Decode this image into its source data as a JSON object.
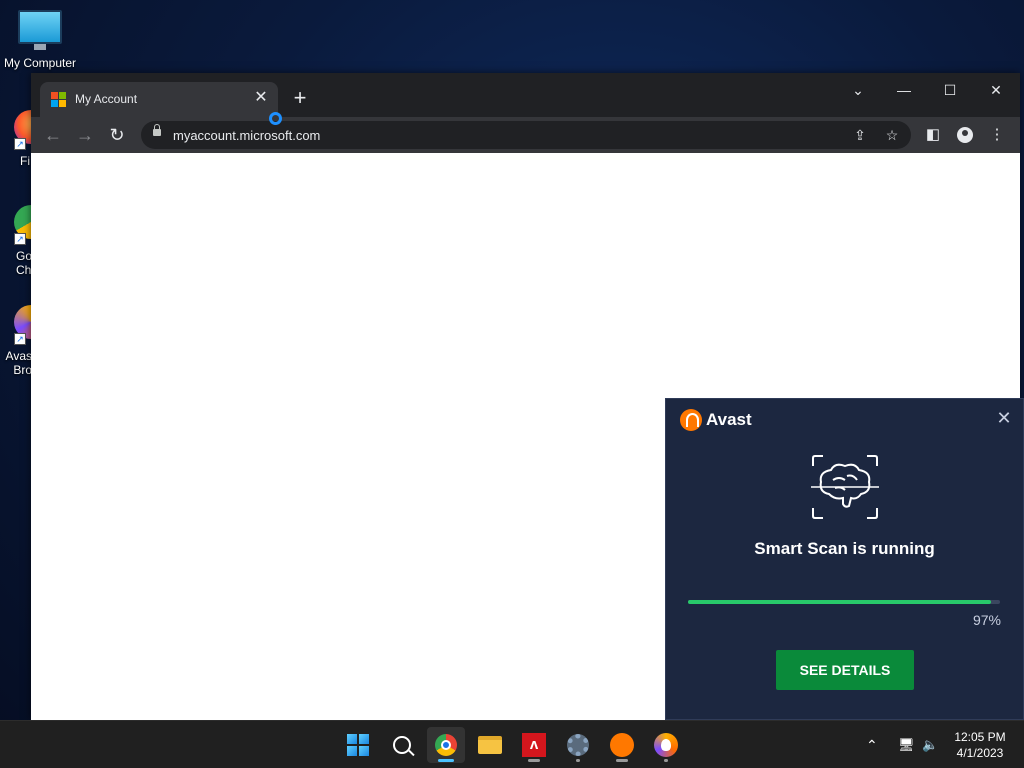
{
  "desktop": {
    "icons": [
      {
        "label": "My Computer",
        "icon": "monitor-icon"
      },
      {
        "label": "Fi",
        "icon": "firefox-icon"
      },
      {
        "label": "Go Ch",
        "icon": "chrome-icon"
      },
      {
        "label": "Avas Bro",
        "icon": "avast-browser-icon"
      }
    ]
  },
  "browser": {
    "tab_title": "My Account",
    "url": "myaccount.microsoft.com"
  },
  "avast_popup": {
    "brand": "Avast",
    "status": "Smart Scan is running",
    "progress_percent": 97,
    "progress_label": "97%",
    "cta_label": "SEE DETAILS",
    "colors": {
      "bg": "#1c2740",
      "progress": "#28c86a",
      "cta": "#0a8a3a",
      "brand": "#ff7800"
    }
  },
  "taskbar": {
    "apps": [
      "start-icon",
      "search-icon",
      "chrome-icon",
      "file-explorer-icon",
      "red-app-icon",
      "settings-gear-icon",
      "avast-icon",
      "avast-browser-icon"
    ],
    "clock_time": "12:05 PM",
    "clock_date": "4/1/2023"
  }
}
